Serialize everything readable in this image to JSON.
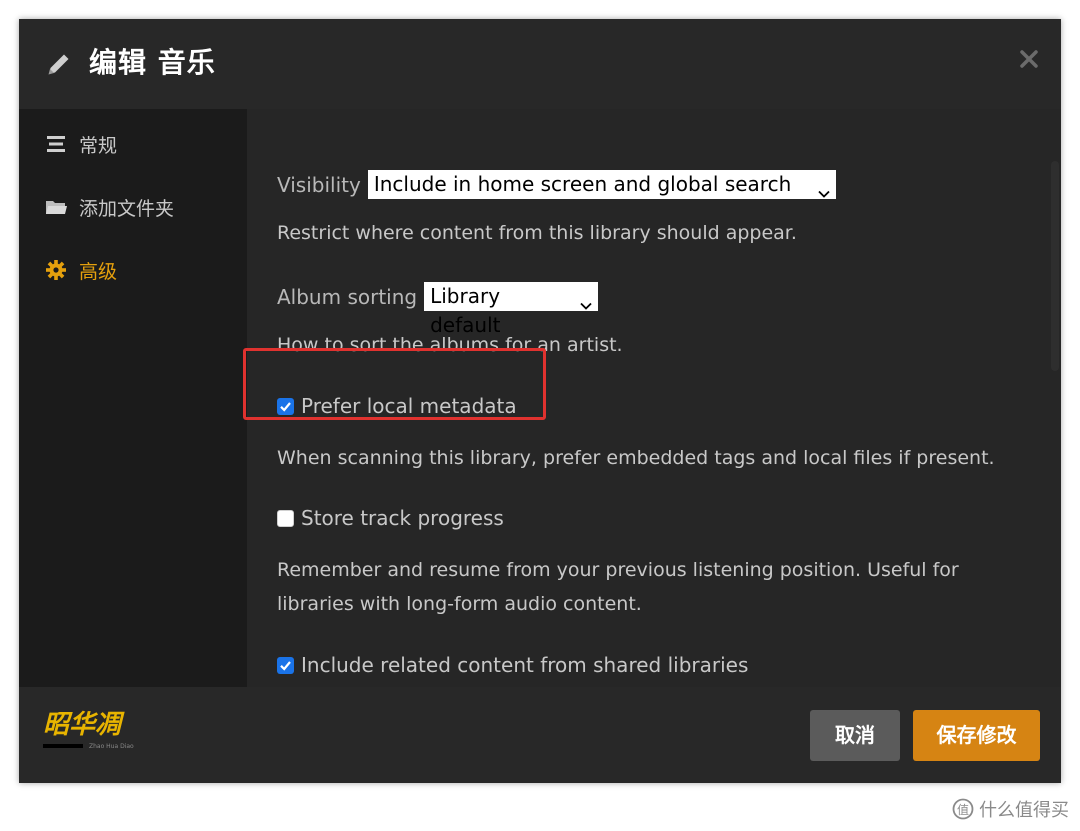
{
  "header": {
    "title": "编辑 音乐",
    "pencil_icon": "pencil-icon",
    "close_icon": "close-icon"
  },
  "sidebar": {
    "items": [
      {
        "label": "常规",
        "icon": "list-icon",
        "active": false
      },
      {
        "label": "添加文件夹",
        "icon": "folder-icon",
        "active": false
      },
      {
        "label": "高级",
        "icon": "gear-icon",
        "active": true
      }
    ]
  },
  "content": {
    "visibility": {
      "label": "Visibility",
      "value": "Include in home screen and global search",
      "description": "Restrict where content from this library should appear."
    },
    "album_sorting": {
      "label": "Album sorting",
      "value": "Library default",
      "description": "How to sort the albums for an artist."
    },
    "prefer_local_metadata": {
      "label": "Prefer local metadata",
      "checked": true,
      "description": "When scanning this library, prefer embedded tags and local files if present."
    },
    "store_track_progress": {
      "label": "Store track progress",
      "checked": false,
      "description_line1": "Remember and resume from your previous listening position. Useful for",
      "description_line2": "libraries with long-form audio content."
    },
    "include_related": {
      "label": "Include related content from shared libraries",
      "checked": true
    }
  },
  "footer": {
    "cancel_label": "取消",
    "save_label": "保存修改"
  },
  "watermark": {
    "text": "值 什么值得买"
  },
  "colors": {
    "accent": "#e5a00d",
    "save_button": "#d68413",
    "cancel_button": "#5b5b5b",
    "checkbox": "#1a73e8",
    "highlight_box": "#e0322f"
  }
}
